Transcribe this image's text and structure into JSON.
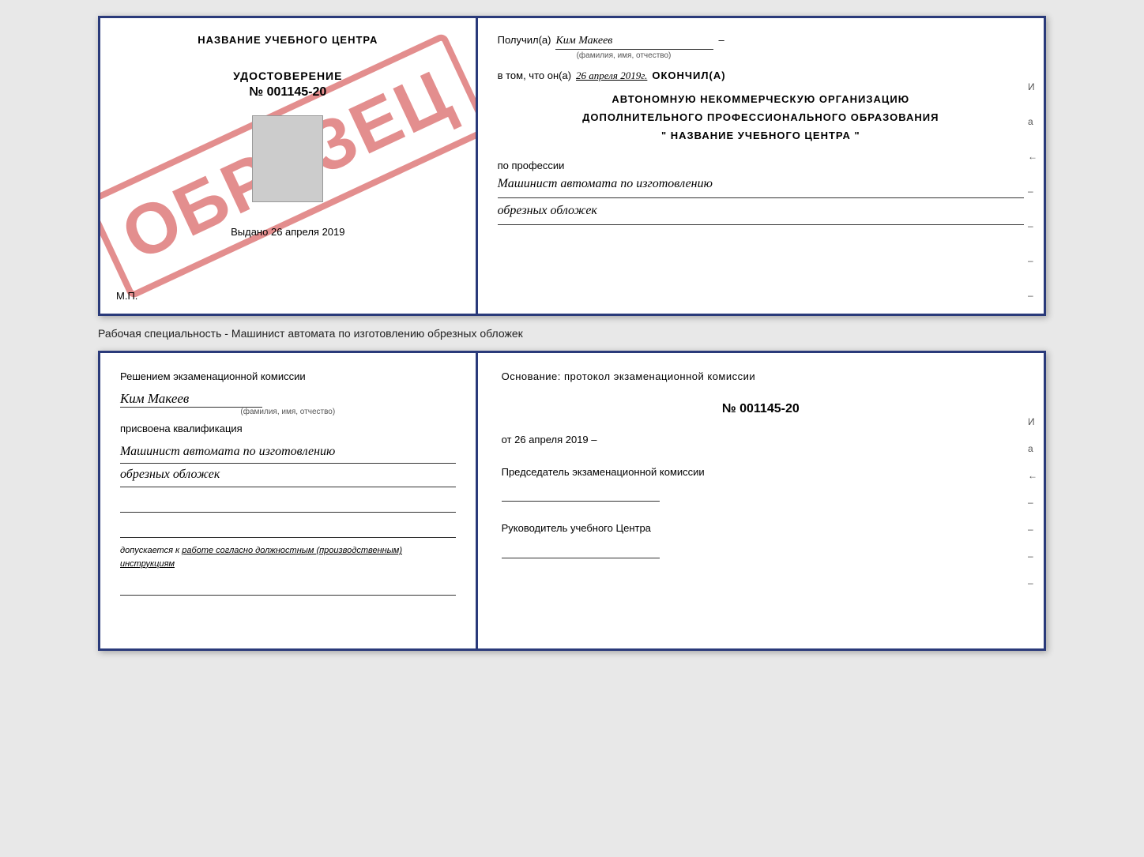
{
  "top_cert": {
    "left": {
      "title": "НАЗВАНИЕ УЧЕБНОГО ЦЕНТРА",
      "stamp_text": "ОБРАЗЕЦ",
      "doc_label": "УДОСТОВЕРЕНИЕ",
      "doc_number": "№ 001145-20",
      "issue_prefix": "Выдано",
      "issue_date": "26 апреля 2019",
      "mp_label": "М.П."
    },
    "right": {
      "received_label": "Получил(а)",
      "person_name": "Ким Макеев",
      "fio_sublabel": "(фамилия, имя, отчество)",
      "in_that_prefix": "в том, что он(а)",
      "in_that_date": "26 апреля 2019г.",
      "finished_label": "окончил(а)",
      "org_line1": "АВТОНОМНУЮ НЕКОММЕРЧЕСКУЮ ОРГАНИЗАЦИЮ",
      "org_line2": "ДОПОЛНИТЕЛЬНОГО ПРОФЕССИОНАЛЬНОГО ОБРАЗОВАНИЯ",
      "org_line3": "\"  НАЗВАНИЕ УЧЕБНОГО ЦЕНТРА  \"",
      "profession_label": "по профессии",
      "profession_line1": "Машинист автомата по изготовлению",
      "profession_line2": "обрезных обложек",
      "side_marks": [
        "И",
        "а",
        "←",
        "–",
        "–",
        "–",
        "–"
      ]
    }
  },
  "middle_label": "Рабочая специальность - Машинист автомата по изготовлению обрезных обложек",
  "bottom_cert": {
    "left": {
      "decision_prefix": "Решением экзаменационной комиссии",
      "person_name": "Ким Макеев",
      "fio_sublabel": "(фамилия, имя, отчество)",
      "assigned_label": "присвоена квалификация",
      "qualification_line1": "Машинист автомата по изготовлению",
      "qualification_line2": "обрезных обложек",
      "allowed_prefix": "допускается к",
      "allowed_text": "работе согласно должностным (производственным) инструкциям"
    },
    "right": {
      "basis_label": "Основание: протокол экзаменационной комиссии",
      "protocol_number": "№ 001145-20",
      "protocol_date_prefix": "от",
      "protocol_date": "26 апреля 2019",
      "chairman_label": "Председатель экзаменационной комиссии",
      "director_label": "Руководитель учебного Центра",
      "side_marks": [
        "И",
        "а",
        "←",
        "–",
        "–",
        "–",
        "–"
      ]
    }
  }
}
